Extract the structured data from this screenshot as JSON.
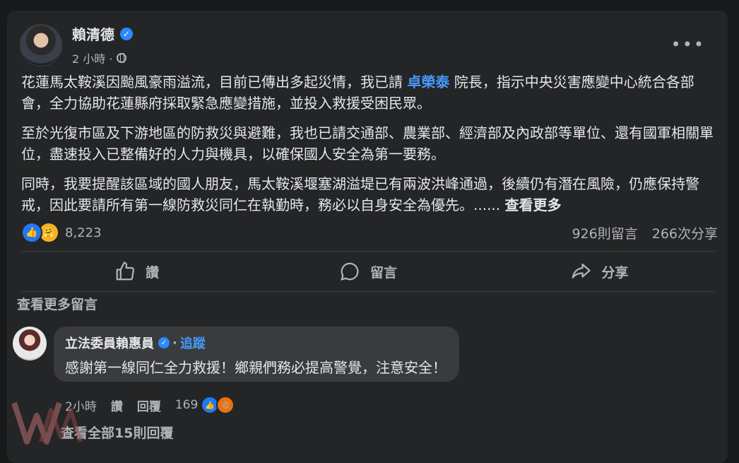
{
  "post": {
    "author": "賴清德",
    "time": "2 小時 ·",
    "paragraphs": {
      "p1_before": "花蓮馬太鞍溪因颱風豪雨溢流，目前已傳出多起災情，我已請 ",
      "p1_mention": "卓榮泰",
      "p1_after": " 院長，指示中央災害應變中心統合各部會，全力協助花蓮縣府採取緊急應變措施，並投入救援受困民眾。",
      "p2": "至於光復市區及下游地區的防救災與避難，我也已請交通部、農業部、經濟部及內政部等單位、還有國軍相關單位，盡速投入已整備好的人力與機具，以確保國人安全為第一要務。",
      "p3": "同時，我要提醒該區域的國人朋友，馬太鞍溪堰塞湖溢堤已有兩波洪峰通過，後續仍有潛在風險，仍應保持警戒，因此要請所有第一線防救災同仁在執勤時，務必以自身安全為優先。......",
      "see_more": "查看更多"
    },
    "reaction_count": "8,223",
    "comments_count": "926則留言",
    "shares_count": "266次分享"
  },
  "actions": {
    "like": "讚",
    "comment": "留言",
    "share": "分享"
  },
  "comments": {
    "view_more": "查看更多留言",
    "item": {
      "author": "立法委員賴惠員",
      "follow": "追蹤",
      "text": "感謝第一線同仁全力救援！鄉親們務必提高警覺，注意安全！",
      "time": "2小時",
      "like": "讚",
      "reply": "回覆",
      "reaction_count": "169"
    },
    "view_all_replies": "查看全部15則回覆"
  },
  "colors": {
    "background": "#18191a",
    "card": "#242526",
    "accent": "#4599ff",
    "like_blue": "#2078f4"
  }
}
